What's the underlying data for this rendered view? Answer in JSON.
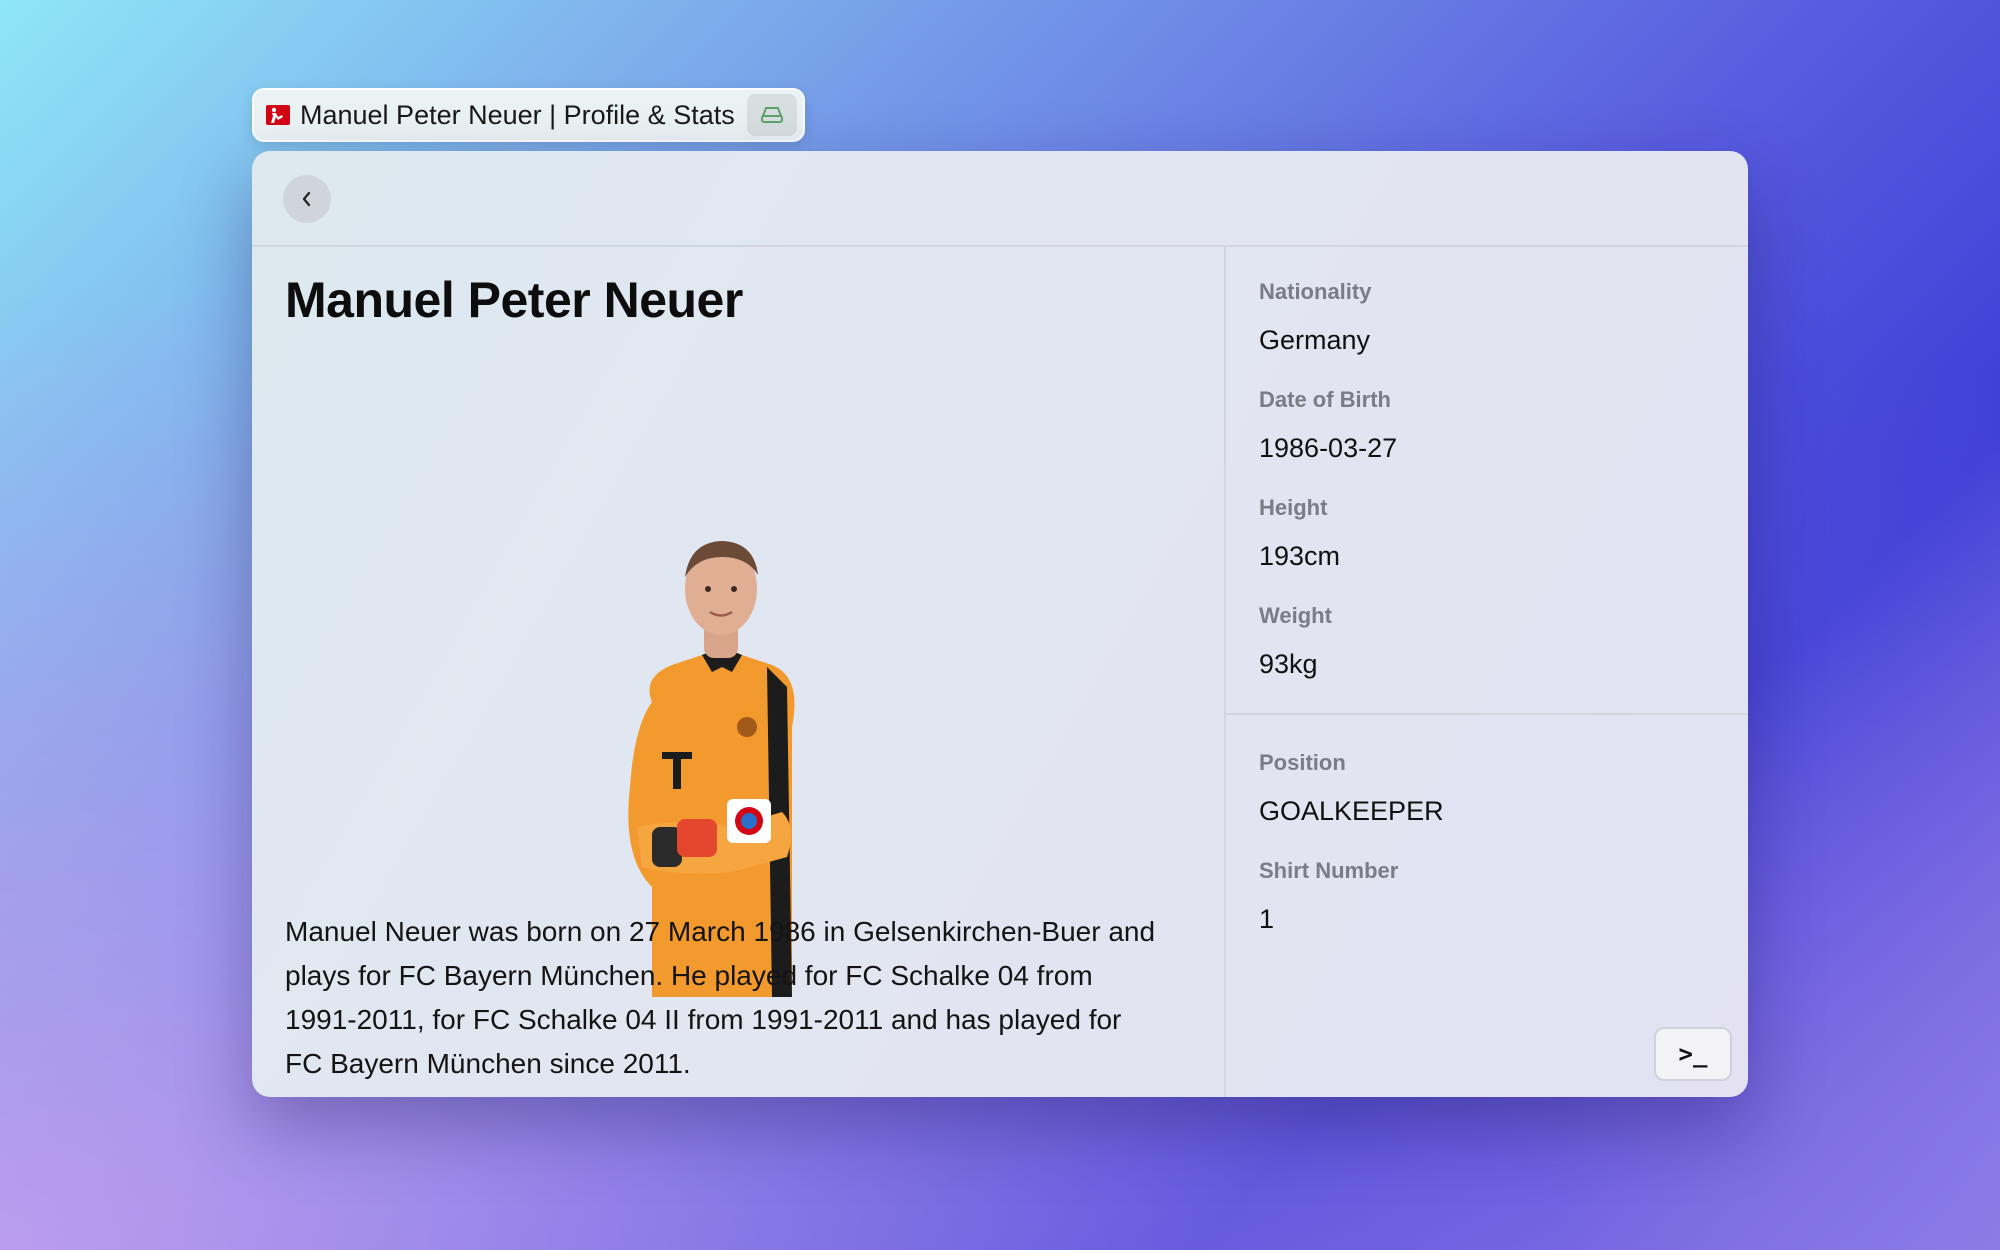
{
  "window": {
    "title": "Manuel Peter Neuer | Profile & Stats"
  },
  "profile": {
    "name": "Manuel Peter Neuer",
    "bio": "Manuel Neuer was born on 27 March 1986 in Gelsenkirchen-Buer and plays for FC Bayern München. He played for FC Schalke 04 from 1991-2011, for FC Schalke 04 II from 1991-2011 and has played for FC Bayern München since 2011."
  },
  "details": {
    "nationality": {
      "label": "Nationality",
      "value": "Germany"
    },
    "dob": {
      "label": "Date of Birth",
      "value": "1986-03-27"
    },
    "height": {
      "label": "Height",
      "value": "193cm"
    },
    "weight": {
      "label": "Weight",
      "value": "93kg"
    },
    "position": {
      "label": "Position",
      "value": "GOALKEEPER"
    },
    "shirt": {
      "label": "Shirt Number",
      "value": "1"
    }
  },
  "toolbar": {
    "terminal_label": ">_"
  },
  "colors": {
    "accent_red": "#d20515",
    "pill_icon_green": "#5aa36a",
    "jersey_orange": "#f39a2e"
  },
  "icons": {
    "app_logo": "bundesliga-logo-icon",
    "pill_button": "drive-icon",
    "back": "chevron-left-icon",
    "terminal": "terminal-icon"
  }
}
